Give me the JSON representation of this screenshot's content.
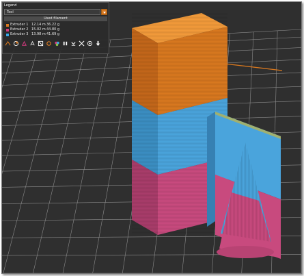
{
  "legend": {
    "title": "Legend",
    "view_selector": "Tool",
    "used_filament_header": "Used filament",
    "extruders": [
      {
        "name": "Extruder 1",
        "length": "12.14 m",
        "weight": "36.22 g",
        "color": "#d8781f"
      },
      {
        "name": "Extruder 2",
        "length": "15.02 m",
        "weight": "44.80 g",
        "color": "#d43a7f"
      },
      {
        "name": "Extruder 3",
        "length": "13.98 m",
        "weight": "41.69 g",
        "color": "#39a9e6"
      }
    ],
    "icons": [
      "travel-icon",
      "wipe-icon",
      "retractions-icon",
      "deretractions-icon",
      "seams-icon",
      "tool-changes-icon",
      "color-changes-icon",
      "pause-prints-icon",
      "custom-gcodes-icon",
      "center-of-gravity-icon",
      "shells-icon",
      "tool-marker-icon"
    ]
  },
  "colors": {
    "background": "#2f2f2f",
    "grid": "#8c8c8c",
    "bed": "#3a3a3a",
    "orange": "#d8781f",
    "blue": "#4aa4dc",
    "pink": "#c84a7e"
  }
}
